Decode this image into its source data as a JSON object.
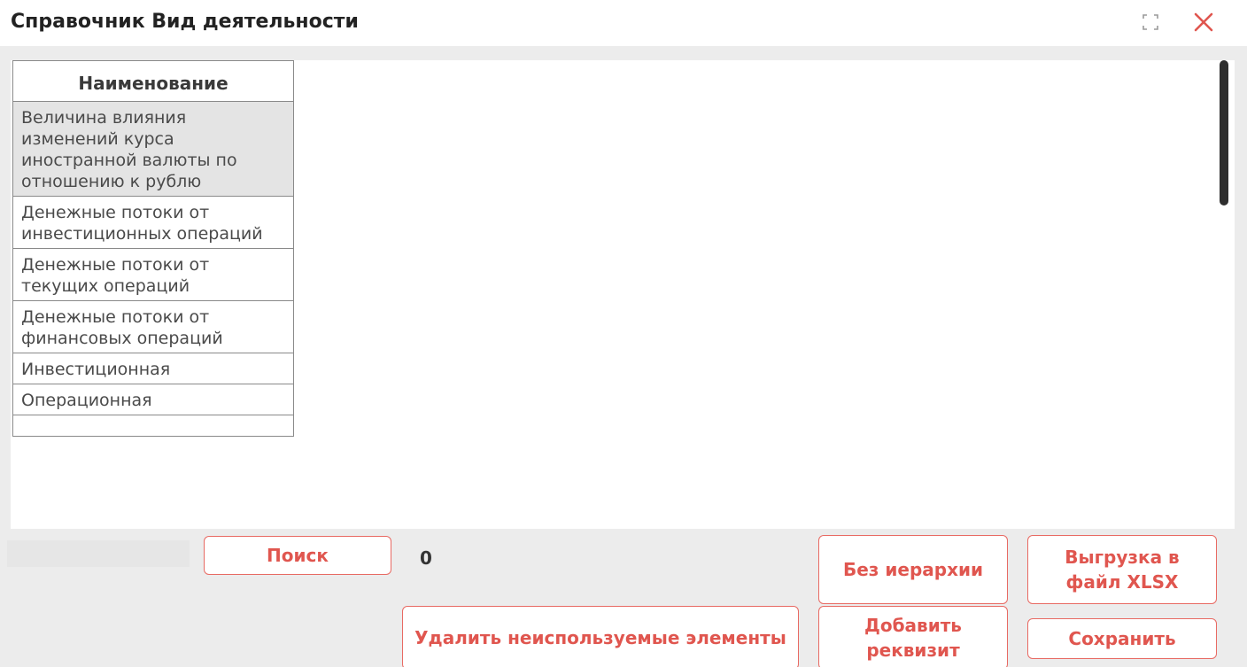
{
  "window": {
    "title": "Справочник Вид деятельности"
  },
  "table": {
    "header": "Наименование",
    "rows": [
      {
        "label": "Величина влияния изменений курса иностранной валюты по отношению к рублю"
      },
      {
        "label": "Денежные потоки от инвестиционных операций"
      },
      {
        "label": "Денежные потоки от текущих операций"
      },
      {
        "label": "Денежные потоки от финансовых операций"
      },
      {
        "label": "Инвестиционная"
      },
      {
        "label": "Операционная"
      }
    ]
  },
  "toolbar": {
    "search_value": "",
    "search_label": "Поиск",
    "count": "0",
    "no_hierarchy_label": "Без иерархии",
    "export_label": "Выгрузка в файл XLSX",
    "delete_unused_label": "Удалить неиспользуемые элементы",
    "add_attribute_label": "Добавить реквизит",
    "save_label": "Сохранить"
  },
  "colors": {
    "accent": "#e0564f",
    "accent_border": "#e86a63",
    "frame_bg": "#ececec",
    "selected_row_bg": "#e4e4e4"
  },
  "icons": {
    "expand": "expand-icon",
    "close": "close-icon"
  }
}
